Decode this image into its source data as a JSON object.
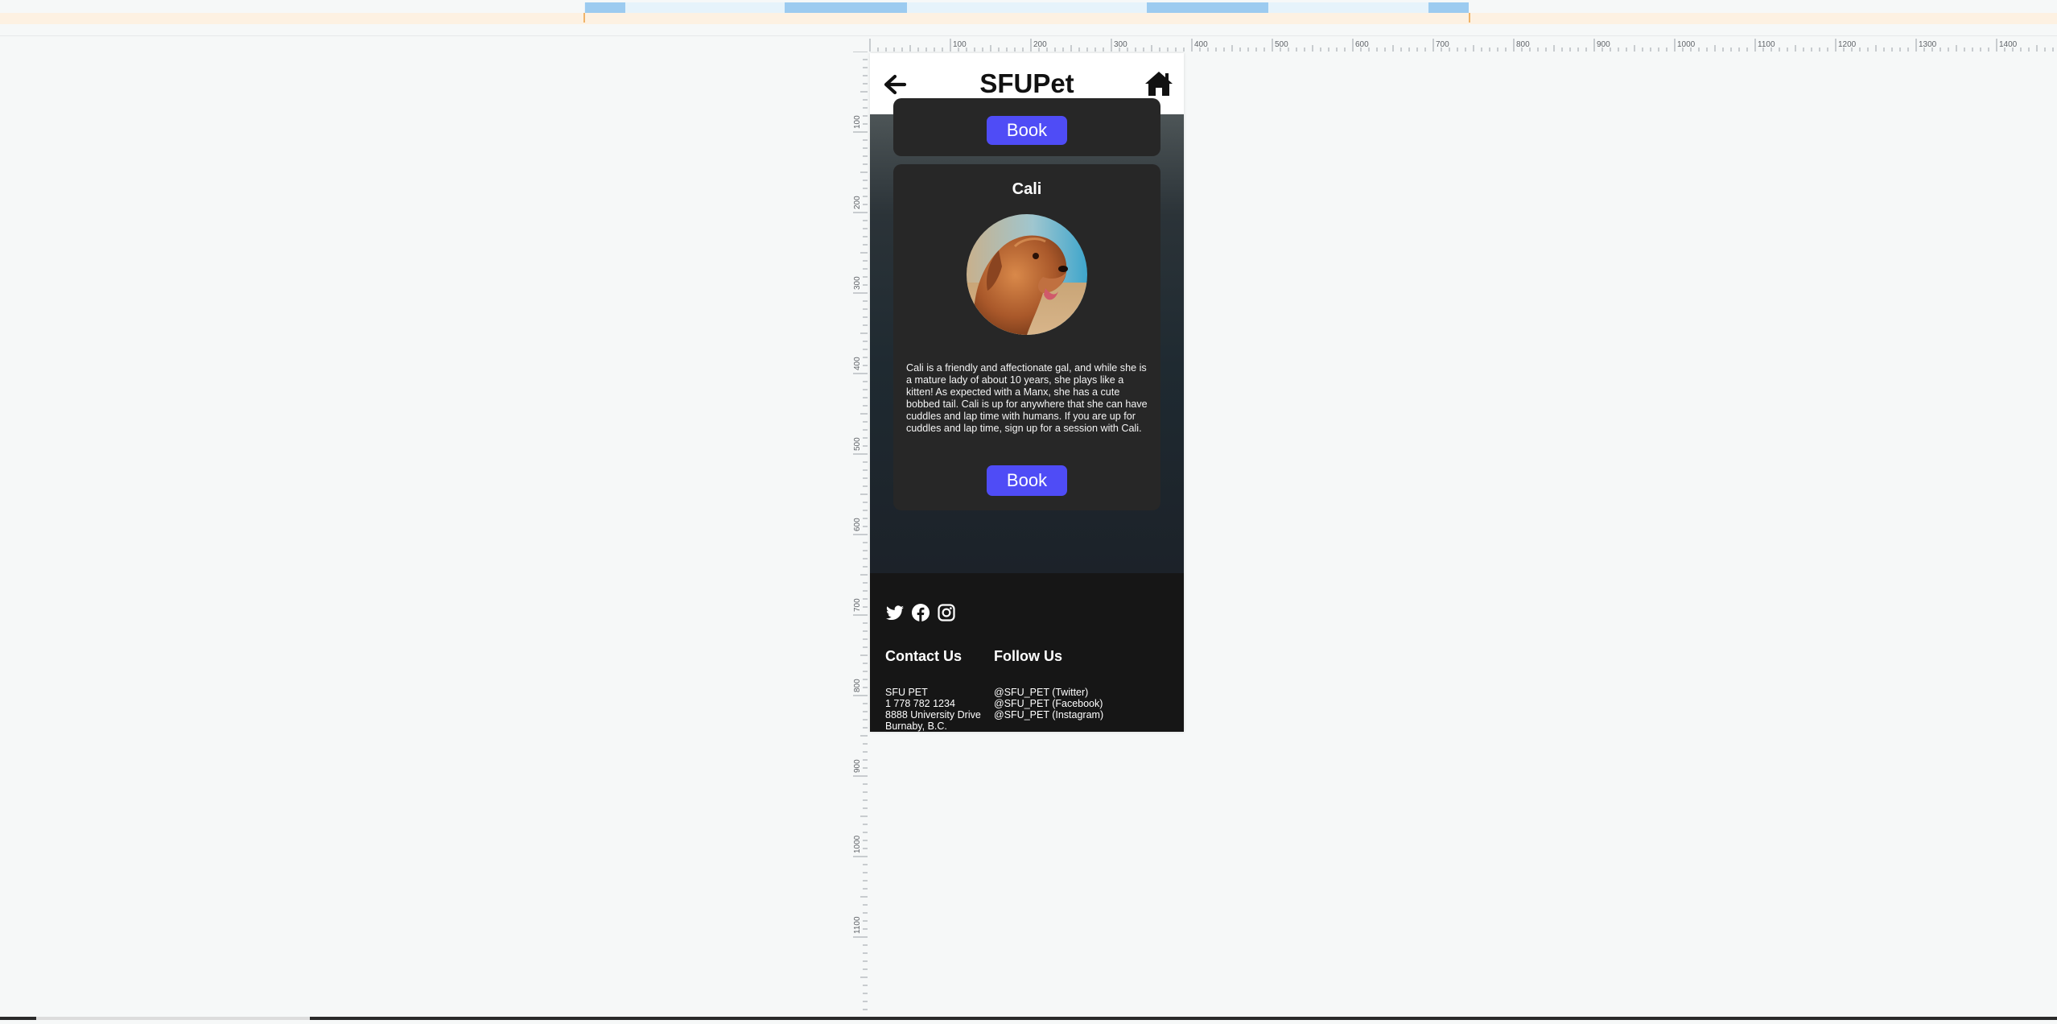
{
  "app": {
    "title": "SFUPet",
    "back_icon": "arrow-left-icon",
    "home_icon": "home-icon"
  },
  "ruler": {
    "h_labels": [
      "100",
      "200",
      "300",
      "400",
      "500",
      "600",
      "700",
      "800",
      "900",
      "1000",
      "1100",
      "1200",
      "1300",
      "1400"
    ],
    "v_labels": [
      "100",
      "200",
      "300",
      "400",
      "500",
      "600",
      "700",
      "800",
      "900",
      "1000",
      "1100"
    ]
  },
  "previous_card": {
    "book_label": "Book"
  },
  "pet_card": {
    "name": "Cali",
    "photo_icon": "dog-photo",
    "description": "Cali is a friendly and affectionate gal, and while she is a mature lady of about 10 years, she plays like a kitten! As expected with a Manx, she has a cute bobbed tail. Cali is up for anywhere that she can have cuddles and lap time with humans. If you are up for cuddles and lap time, sign up for a session with Cali.",
    "book_label": "Book"
  },
  "footer": {
    "social_icons": [
      "twitter-icon",
      "facebook-icon",
      "instagram-icon"
    ],
    "contact_title": "Contact Us",
    "contact_lines": [
      "SFU PET",
      "1 778 782 1234",
      "8888 University Drive",
      "Burnaby, B.C."
    ],
    "follow_title": "Follow Us",
    "follow_lines": [
      "@SFU_PET (Twitter)",
      "@SFU_PET (Facebook)",
      "@SFU_PET (Instagram)"
    ]
  },
  "colors": {
    "accent": "#4f4cf6",
    "card": "#272727",
    "footer": "#161616"
  }
}
